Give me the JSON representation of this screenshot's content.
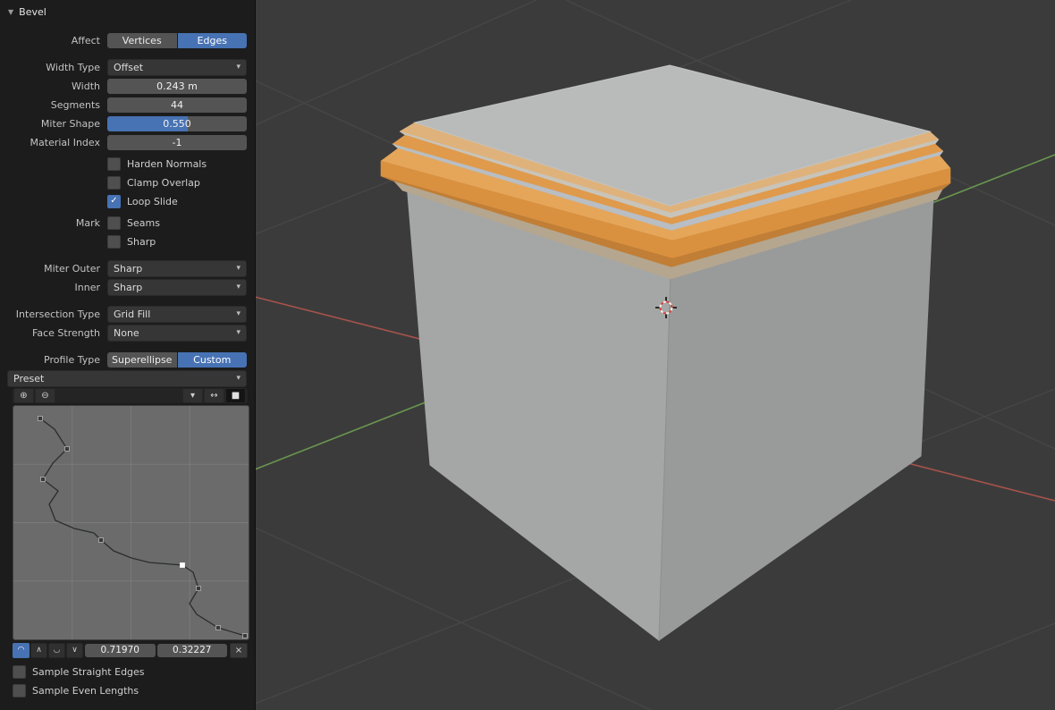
{
  "colors": {
    "accent_blue": "#4772b3",
    "panel_bg": "#1c1c1c",
    "field_gray": "#545454",
    "viewport_bg": "#3b3b3b",
    "bevel_orange": "#d99140",
    "axis_green": "#69964f",
    "axis_red": "#a8534b"
  },
  "panel": {
    "title": "Bevel",
    "affect": {
      "label": "Affect",
      "options": [
        "Vertices",
        "Edges"
      ],
      "active": "Edges"
    },
    "width_type": {
      "label": "Width Type",
      "value": "Offset"
    },
    "width": {
      "label": "Width",
      "value": "0.243 m"
    },
    "segments": {
      "label": "Segments",
      "value": "44"
    },
    "miter_shape": {
      "label": "Miter Shape",
      "value": "0.550"
    },
    "material_index": {
      "label": "Material Index",
      "value": "-1"
    },
    "harden_normals": {
      "label": "Harden Normals",
      "checked": false
    },
    "clamp_overlap": {
      "label": "Clamp Overlap",
      "checked": false
    },
    "loop_slide": {
      "label": "Loop Slide",
      "checked": true
    },
    "mark": {
      "label": "Mark",
      "seams": {
        "label": "Seams",
        "checked": false
      },
      "sharp": {
        "label": "Sharp",
        "checked": false
      }
    },
    "miter_outer": {
      "label": "Miter Outer",
      "value": "Sharp"
    },
    "miter_inner": {
      "label": "Inner",
      "value": "Sharp"
    },
    "intersection_type": {
      "label": "Intersection Type",
      "value": "Grid Fill"
    },
    "face_strength": {
      "label": "Face Strength",
      "value": "None"
    },
    "profile_type": {
      "label": "Profile Type",
      "options": [
        "Superellipse",
        "Custom"
      ],
      "active": "Custom"
    },
    "preset": {
      "label": "Preset"
    },
    "sample_straight": {
      "label": "Sample Straight Edges",
      "checked": false
    },
    "sample_even": {
      "label": "Sample Even Lengths",
      "checked": false
    }
  },
  "icons": {
    "collapse_triangle": "▼",
    "zoom_in": "⊕",
    "zoom_out": "⊖",
    "caret": "▾",
    "clipping": "↔",
    "extend": "■",
    "handle_auto": "◠",
    "handle_vector": "∧",
    "handle_free": "◡",
    "handle_align": "∨",
    "delete": "×",
    "check": "✓"
  },
  "profile_widget": {
    "selected_point_x": "0.71970",
    "selected_point_y": "0.32227",
    "curve": {
      "path": [
        [
          30,
          14
        ],
        [
          46,
          26
        ],
        [
          60,
          48
        ],
        [
          44,
          64
        ],
        [
          33,
          82
        ],
        [
          50,
          95
        ],
        [
          40,
          110
        ],
        [
          47,
          128
        ],
        [
          68,
          137
        ],
        [
          90,
          142
        ],
        [
          98,
          150
        ],
        [
          112,
          162
        ],
        [
          132,
          170
        ],
        [
          152,
          175
        ],
        [
          189,
          178
        ],
        [
          201,
          186
        ],
        [
          207,
          204
        ],
        [
          197,
          221
        ],
        [
          205,
          233
        ],
        [
          229,
          248
        ],
        [
          259,
          257
        ]
      ],
      "points": [
        [
          30,
          14
        ],
        [
          60,
          48
        ],
        [
          33,
          82
        ],
        [
          98,
          150
        ],
        [
          189,
          178
        ],
        [
          207,
          204
        ],
        [
          229,
          248
        ],
        [
          259,
          257
        ]
      ],
      "selected_index": 4
    }
  }
}
